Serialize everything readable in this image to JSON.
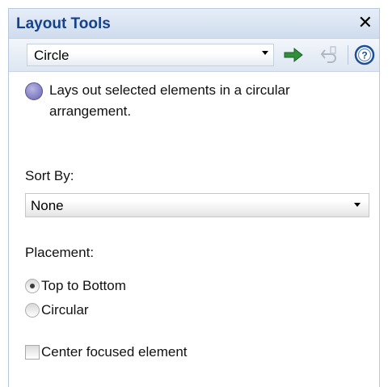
{
  "panel": {
    "title": "Layout Tools",
    "close_glyph": "✕"
  },
  "toolbar": {
    "layout_select": {
      "value": "Circle"
    },
    "icons": [
      "apply-arrow-icon",
      "undo-icon",
      "help-icon"
    ]
  },
  "description": {
    "icon": "circle-layout-icon",
    "text": "Lays out selected elements in a circular arrangement."
  },
  "sort_by": {
    "label": "Sort By:",
    "value": "None"
  },
  "placement": {
    "label": "Placement:",
    "options": [
      {
        "label": "Top to Bottom",
        "checked": true
      },
      {
        "label": "Circular",
        "checked": false
      }
    ]
  },
  "center_focused": {
    "label": "Center focused element",
    "checked": false
  },
  "colors": {
    "title_text": "#15428b",
    "apply_arrow": "#2f8f3a",
    "help_icon": "#1a4f9c"
  }
}
